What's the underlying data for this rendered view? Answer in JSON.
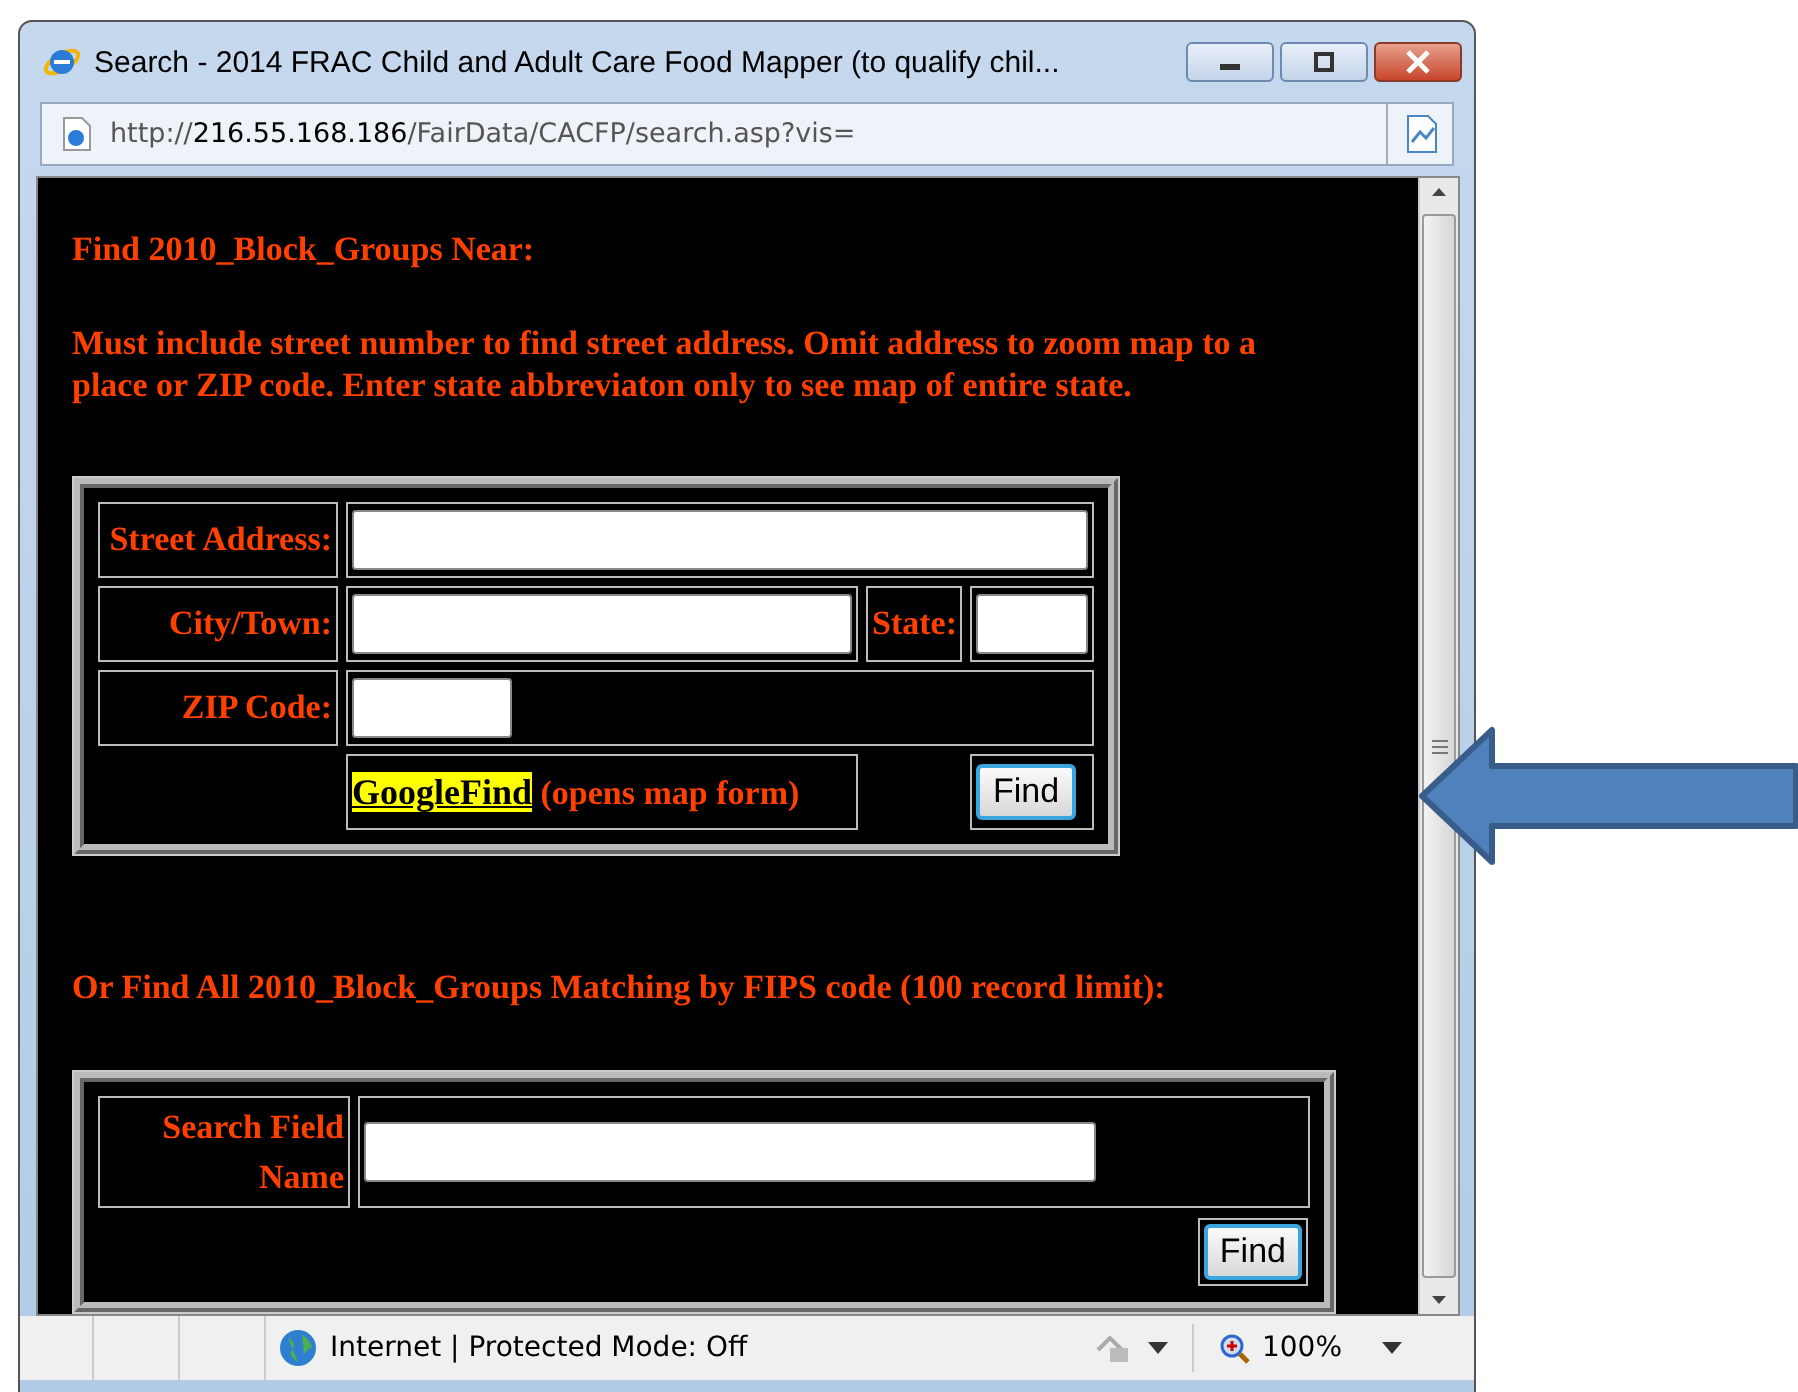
{
  "window": {
    "title": "Search - 2014 FRAC Child and Adult Care Food Mapper (to qualify chil..."
  },
  "address_bar": {
    "scheme": "http://",
    "host": "216.55.168.186",
    "path": "/FairData/CACFP/search.asp?vis="
  },
  "near_search": {
    "heading": "Find 2010_Block_Groups Near:",
    "instructions": "Must include street number to find street address. Omit address to zoom map to a place or ZIP code. Enter state abbreviaton only to see map of entire state.",
    "street_label": "Street Address:",
    "city_label": "City/Town:",
    "state_label": "State:",
    "zip_label": "ZIP Code:",
    "google_link": "GoogleFind",
    "google_note": "(opens map form)",
    "find_button": "Find"
  },
  "fips_search": {
    "heading": "Or Find All 2010_Block_Groups Matching by FIPS code (100 record limit):",
    "field_label": "Search Field Name",
    "find_button": "Find"
  },
  "status_bar": {
    "zone": "Internet | Protected Mode: Off",
    "zoom": "100%"
  }
}
